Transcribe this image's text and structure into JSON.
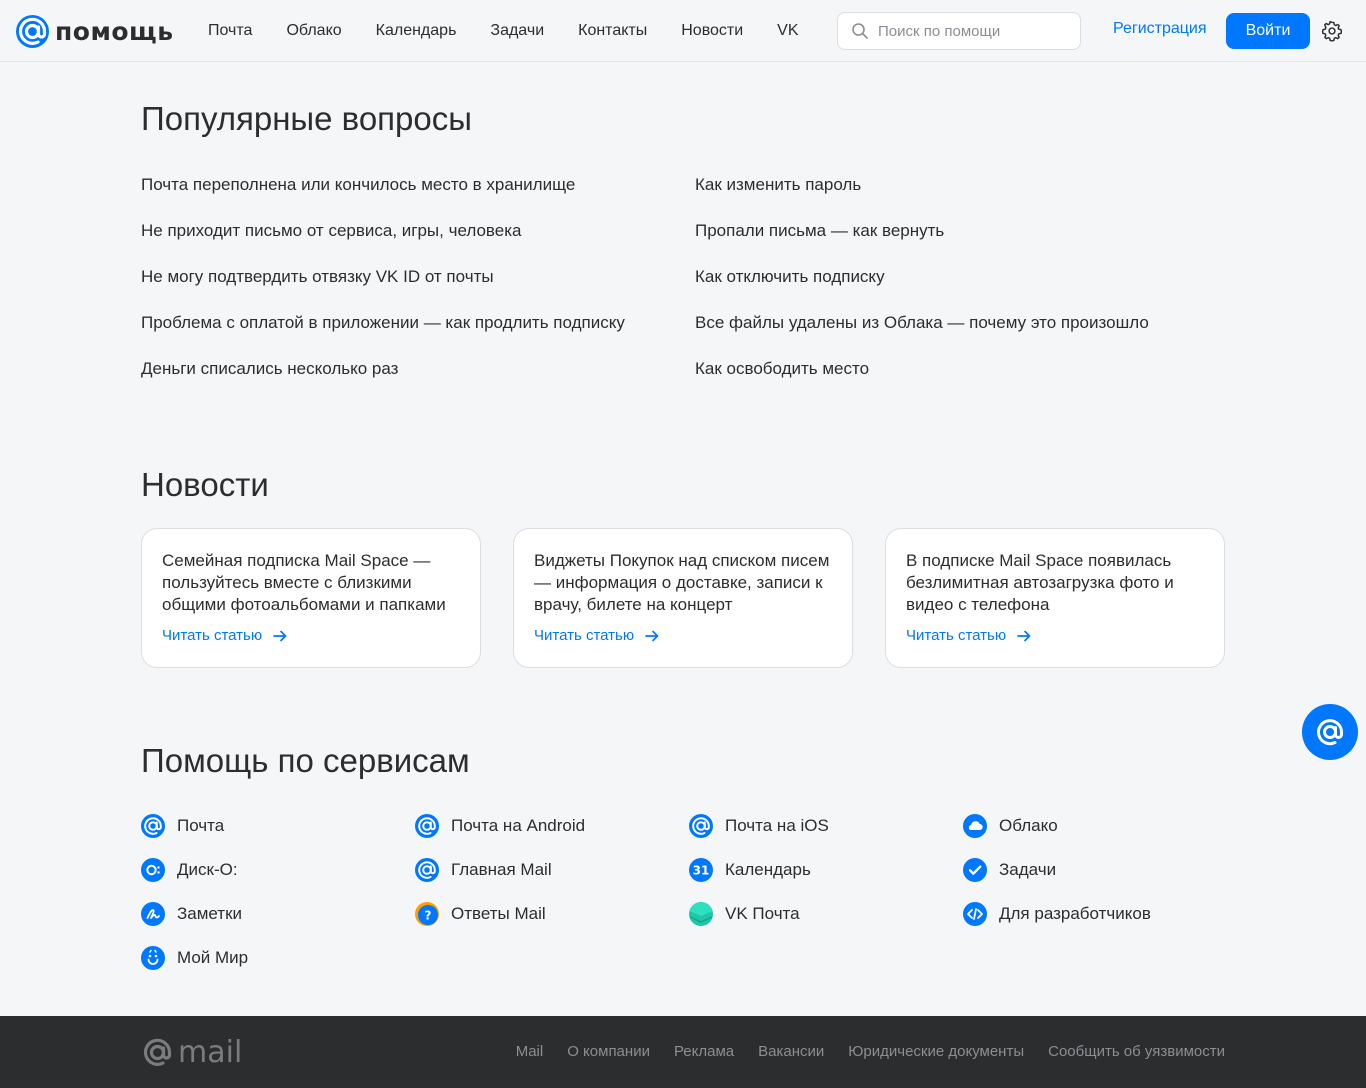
{
  "header": {
    "logo_text": "помощь",
    "nav": [
      "Почта",
      "Облако",
      "Календарь",
      "Задачи",
      "Контакты",
      "Новости",
      "VK"
    ],
    "search_placeholder": "Поиск по помощи",
    "register_label": "Регистрация",
    "login_label": "Войти"
  },
  "faq": {
    "title": "Популярные вопросы",
    "left": [
      "Почта переполнена или кончилось место в хранилище",
      "Не приходит письмо от сервиса, игры, человека",
      "Не могу подтвердить отвязку VK ID от почты",
      "Проблема с оплатой в приложении — как продлить подписку",
      "Деньги списались несколько раз"
    ],
    "right": [
      "Как изменить пароль",
      "Пропали письма — как вернуть",
      "Как отключить подписку",
      "Все файлы удалены из Облака — почему это произошло",
      "Как освободить место"
    ]
  },
  "news": {
    "title": "Новости",
    "read_label": "Читать статью",
    "items": [
      "Семейная подписка Mail Space — пользуйтесь вместе с близкими общими фотоальбомами и папками",
      "Виджеты Покупок над списком писем — информация о доставке, записи к врачу, билете на концерт",
      "В подписке Mail Space появилась безлимитная автозагрузка фото и видео с телефона"
    ]
  },
  "services": {
    "title": "Помощь по сервисам",
    "items": [
      {
        "label": "Почта",
        "icon": "mail-icon"
      },
      {
        "label": "Почта на Android",
        "icon": "mail-android-icon"
      },
      {
        "label": "Почта на iOS",
        "icon": "mail-ios-icon"
      },
      {
        "label": "Облако",
        "icon": "cloud-icon"
      },
      {
        "label": "Диск-О:",
        "icon": "disk-o-icon"
      },
      {
        "label": "Главная Mail",
        "icon": "main-mail-icon"
      },
      {
        "label": "Календарь",
        "icon": "calendar-icon"
      },
      {
        "label": "Задачи",
        "icon": "tasks-icon"
      },
      {
        "label": "Заметки",
        "icon": "notes-icon"
      },
      {
        "label": "Ответы Mail",
        "icon": "answers-icon"
      },
      {
        "label": "VK Почта",
        "icon": "vk-mail-icon"
      },
      {
        "label": "Для разработчиков",
        "icon": "developers-icon"
      },
      {
        "label": "Мой Мир",
        "icon": "my-world-icon"
      }
    ]
  },
  "footer": {
    "logo_text": "mail",
    "links": [
      "Mail",
      "О компании",
      "Реклама",
      "Вакансии",
      "Юридические документы",
      "Сообщить об уязвимости"
    ]
  },
  "colors": {
    "accent": "#0077ff",
    "background": "#f5f6f8",
    "footer_bg": "#2c2d2e"
  }
}
